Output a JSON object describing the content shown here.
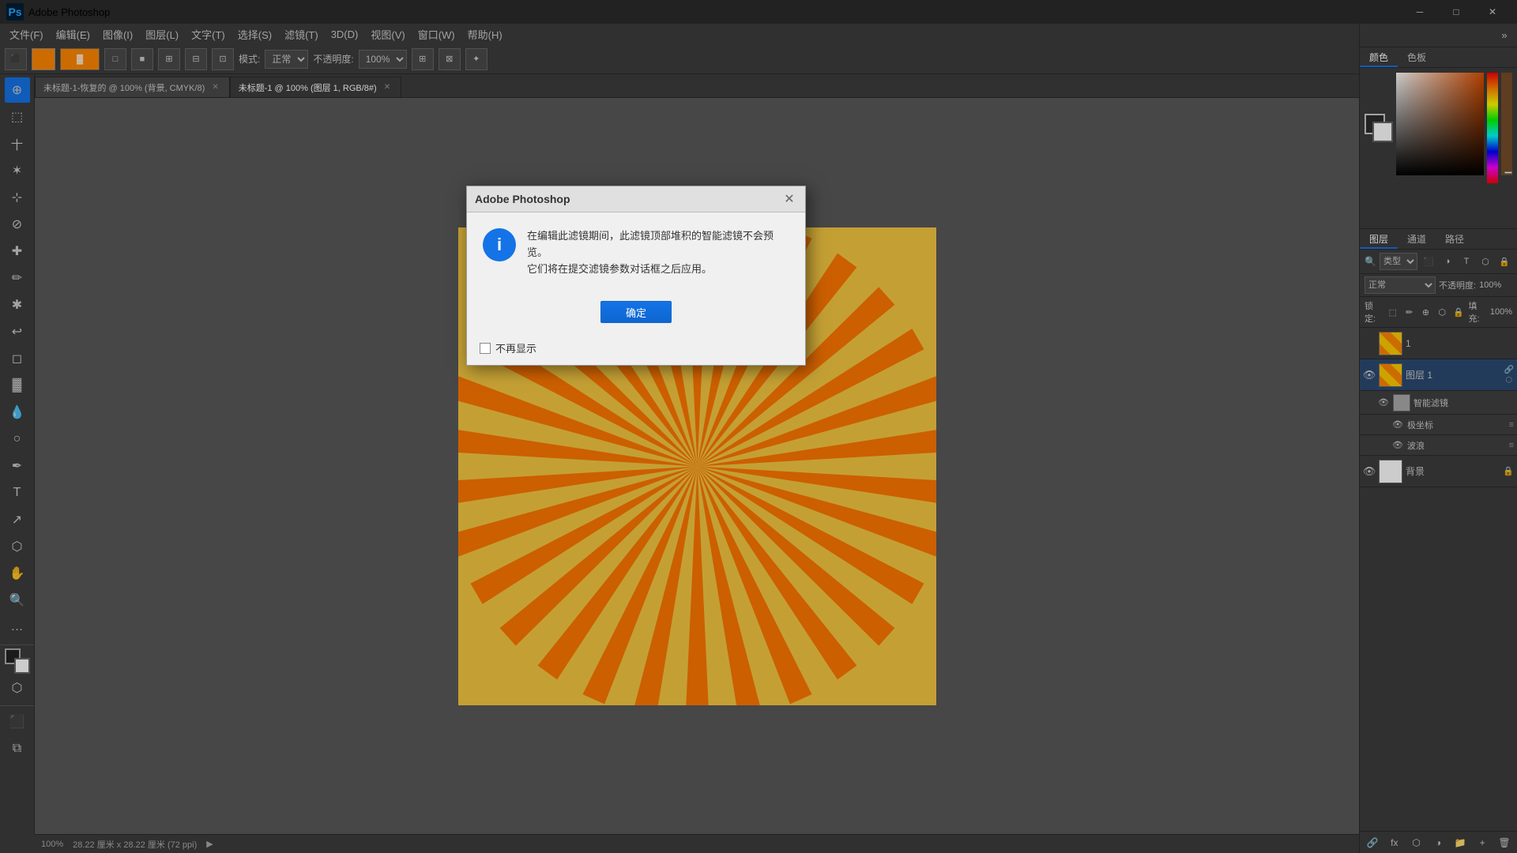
{
  "titlebar": {
    "app_name": "Adobe Photoshop",
    "window_title": "Adobe Photoshop",
    "min_btn": "─",
    "max_btn": "□",
    "close_btn": "✕"
  },
  "menubar": {
    "items": [
      "文件(F)",
      "编辑(E)",
      "图像(I)",
      "图层(L)",
      "文字(T)",
      "选择(S)",
      "滤镜(T)",
      "3D(D)",
      "视图(V)",
      "窗口(W)",
      "帮助(H)"
    ]
  },
  "toolbar": {
    "mode_label": "模式:",
    "mode_value": "正常",
    "opacity_label": "不透明度:",
    "opacity_value": "100%"
  },
  "tabs": [
    {
      "label": "未标题-1-恢复的 @ 100% (背景, CMYK/8)",
      "active": false
    },
    {
      "label": "未标题-1 @ 100% (图层 1, RGB/8#)",
      "active": true
    }
  ],
  "tools": [
    "↔",
    "◻",
    "🔲",
    "➕",
    "↕",
    "〰",
    "✏",
    "🎨",
    "T",
    "⬛",
    "🔍",
    "⬡",
    "✱",
    "⊕",
    "🌀",
    "↗"
  ],
  "dialog": {
    "title": "Adobe Photoshop",
    "message_line1": "在编辑此滤镜期间，此滤镜顶部堆积的智能滤镜不会预览。",
    "message_line2": "它们将在提交滤镜参数对话框之后应用。",
    "confirm_btn": "确定",
    "no_show_label": "不再显示",
    "icon_text": "i"
  },
  "layers_panel": {
    "tabs": [
      "图层",
      "通道",
      "路径"
    ],
    "blend_mode": "正常",
    "opacity_label": "不透明度:",
    "opacity_value": "100%",
    "lock_label": "锁定:",
    "fill_label": "填充:",
    "fill_value": "100%",
    "search_placeholder": "类型",
    "layers": [
      {
        "name": "1",
        "type": "normal",
        "visible": false,
        "thumb": "sunburst"
      },
      {
        "name": "图层 1",
        "type": "smart",
        "visible": true,
        "thumb": "sunburst"
      },
      {
        "name": "智能滤镜",
        "type": "smart-filter-header"
      },
      {
        "name": "极坐标",
        "type": "filter-item"
      },
      {
        "name": "波浪",
        "type": "filter-item"
      },
      {
        "name": "背景",
        "type": "background",
        "visible": true,
        "thumb": "white",
        "locked": true
      }
    ]
  },
  "color_panel": {
    "tabs": [
      "颜色",
      "色板"
    ],
    "active_tab": "颜色"
  },
  "statusbar": {
    "zoom": "100%",
    "size": "28.22 厘米 x 28.22 厘米 (72 ppi)"
  }
}
